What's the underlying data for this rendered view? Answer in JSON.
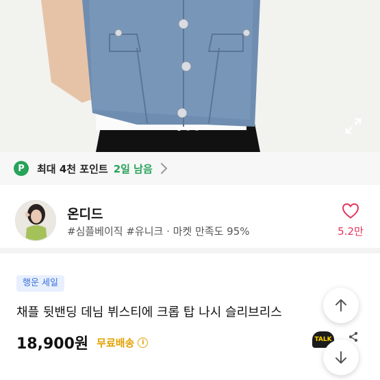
{
  "hero": {
    "image_desc": "denim-crop-vest-photo",
    "slide_count": 3,
    "active_slide": 0
  },
  "points": {
    "badge": "P",
    "text": "최대 4천 포인트",
    "remain": "2일 남음"
  },
  "shop": {
    "name": "온디드",
    "tags": "#심플베이직 #유니크 · 마켓 만족도 95%",
    "favorite_count": "5.2만"
  },
  "product": {
    "badge": "행운 세일",
    "title": "채플 뒷밴딩 데님 뷔스티에 크롭 탑 나시 슬리브리스",
    "price": "18,900원",
    "shipping": "무료배송",
    "info_icon": "i"
  },
  "colors": {
    "accent_green": "#27a35a",
    "heart_pink": "#e6325a",
    "shipping_gold": "#e1a100",
    "badge_blue": "#3a6fd8"
  },
  "floating": {
    "talk_label": "TALK"
  }
}
